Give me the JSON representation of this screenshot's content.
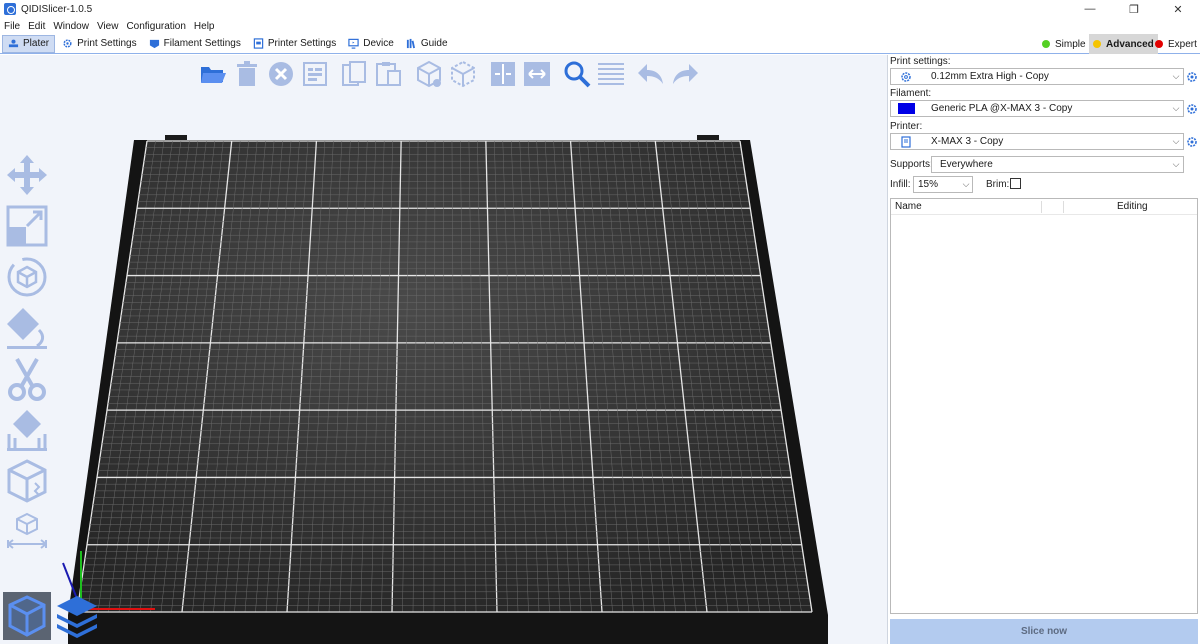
{
  "window": {
    "title": "QIDISlicer-1.0.5",
    "minimize": "—",
    "maximize": "❐",
    "close": "✕"
  },
  "menu": [
    "File",
    "Edit",
    "Window",
    "View",
    "Configuration",
    "Help"
  ],
  "tabs": [
    {
      "label": "Plater",
      "icon": "plater-icon",
      "active": true
    },
    {
      "label": "Print Settings",
      "icon": "gear-icon"
    },
    {
      "label": "Filament Settings",
      "icon": "filament-icon"
    },
    {
      "label": "Printer Settings",
      "icon": "printer-icon"
    },
    {
      "label": "Device",
      "icon": "device-icon"
    },
    {
      "label": "Guide",
      "icon": "guide-icon"
    }
  ],
  "modes": [
    {
      "label": "Simple",
      "color": "#55d024"
    },
    {
      "label": "Advanced",
      "color": "#f5c400",
      "active": true
    },
    {
      "label": "Expert",
      "color": "#e30000"
    }
  ],
  "toolbar_icons": [
    "open-folder-icon",
    "delete-icon",
    "delete-all-icon",
    "arrange-icon",
    "copy-icon",
    "paste-icon",
    "add-instance-icon",
    "remove-instance-icon",
    "split-objects-icon",
    "split-parts-icon",
    "search-icon",
    "layers-editing-icon",
    "undo-icon",
    "redo-icon"
  ],
  "left_tools": [
    "move-icon",
    "scale-icon",
    "rotate-icon",
    "place-on-face-icon",
    "cut-icon",
    "support-paint-icon",
    "seam-paint-icon",
    "measure-icon"
  ],
  "sidebar": {
    "print_settings_label": "Print settings:",
    "print_settings_value": "0.12mm Extra High - Copy",
    "filament_label": "Filament:",
    "filament_value": "Generic PLA @X-MAX 3 - Copy",
    "filament_color": "#0000e6",
    "printer_label": "Printer:",
    "printer_value": "X-MAX 3 - Copy",
    "supports_label": "Supports:",
    "supports_value": "Everywhere",
    "infill_label": "Infill:",
    "infill_value": "15%",
    "brim_label": "Brim:",
    "brim_checked": false,
    "list_headers": {
      "name": "Name",
      "editing": "Editing"
    },
    "slice_button": "Slice now"
  },
  "colors": {
    "accent": "#2e6fd8",
    "bed": "#2a2a2a",
    "viewport_bg": "#f1f4fa"
  }
}
